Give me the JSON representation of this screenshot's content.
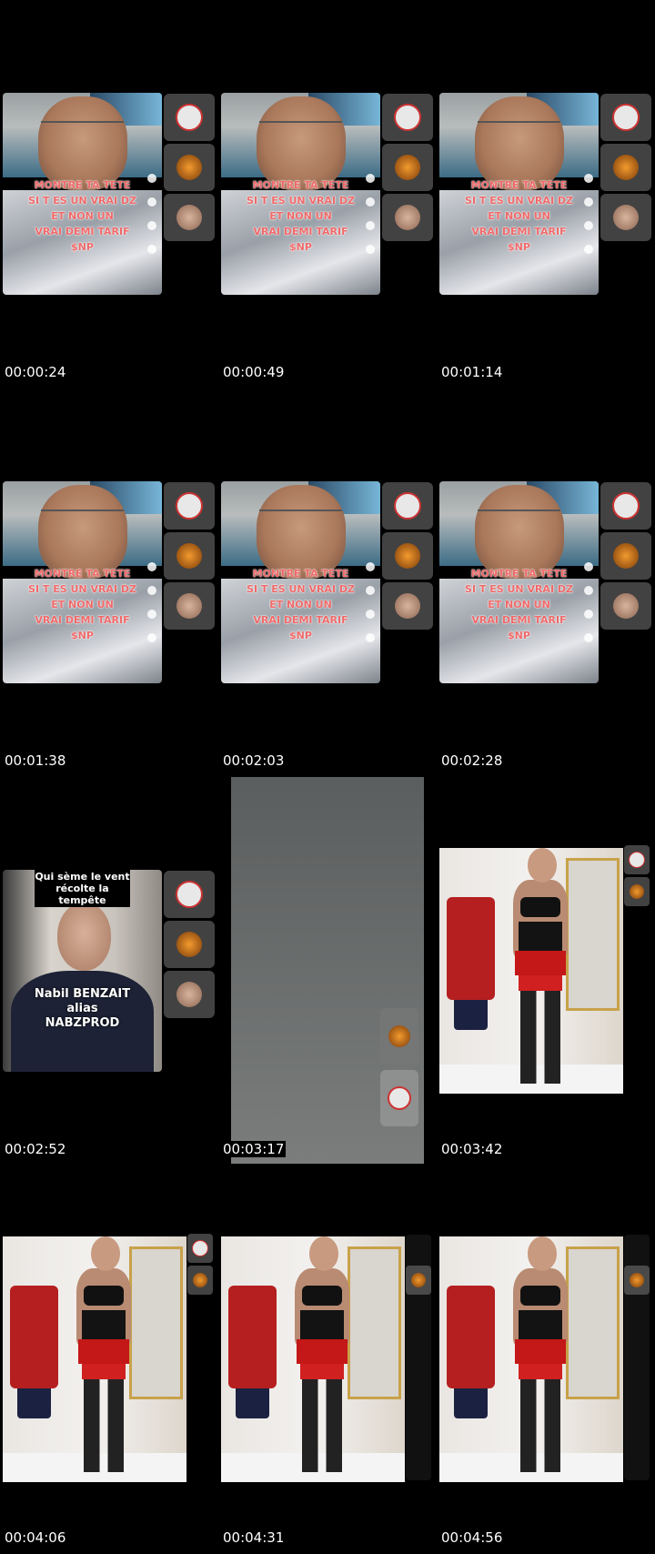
{
  "timestamps": [
    "00:00:24",
    "00:00:49",
    "00:01:14",
    "00:01:38",
    "00:02:03",
    "00:02:28",
    "00:02:52",
    "00:03:17",
    "00:03:42",
    "00:04:06",
    "00:04:31",
    "00:04:56"
  ],
  "selfie_caption": [
    "MONTRE TA TETE",
    "SI T ES UN VRAI DZ",
    "ET NON UN",
    "VRAI DEMI TARIF",
    "$NP"
  ],
  "portrait": {
    "top_caption": [
      "Qui sème le vent",
      "récolte la tempête"
    ],
    "name": [
      "Nabil BENZAIT",
      "alias",
      "NABZPROD"
    ]
  },
  "colors": {
    "background": "#000000",
    "caption_text": "#f06a6a",
    "timestamp_text": "#ffffff"
  },
  "icons": [
    "dice-avatar-icon",
    "orange-avatar-icon",
    "face-avatar-icon",
    "heart-icon",
    "comment-icon",
    "bookmark-icon",
    "share-icon"
  ]
}
